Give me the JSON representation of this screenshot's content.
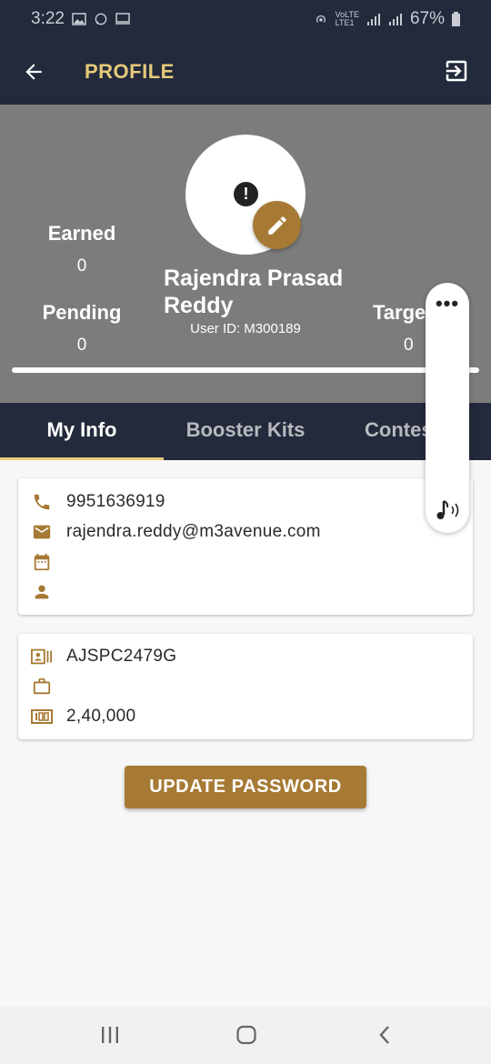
{
  "status_bar": {
    "time": "3:22",
    "network_top": "VoLTE",
    "network_bottom": "LTE1",
    "battery": "67%"
  },
  "app_bar": {
    "title": "PROFILE",
    "back_icon": "arrow-left-icon",
    "logout_icon": "logout-icon"
  },
  "profile": {
    "earned_label": "Earned",
    "earned_value": "0",
    "pending_label": "Pending",
    "pending_value": "0",
    "target_label": "Target",
    "target_value": "0",
    "name": "Rajendra Prasad Reddy",
    "user_id": "User ID: M300189",
    "alert_mark": "!"
  },
  "tabs": [
    {
      "label": "My Info",
      "active": true
    },
    {
      "label": "Booster Kits",
      "active": false
    },
    {
      "label": "Contests",
      "active": false
    }
  ],
  "info_card": {
    "phone": "9951636919",
    "email": "rajendra.reddy@m3avenue.com",
    "date": "",
    "person": ""
  },
  "id_card": {
    "pan": "AJSPC2479G",
    "job": "",
    "amount": "2,40,000"
  },
  "update_button": "UPDATE PASSWORD",
  "float_panel": {
    "dots": "•••"
  },
  "colors": {
    "dark_navy": "#232a3b",
    "gold": "#e6c97a",
    "brown_accent": "#a67a34",
    "header_gray": "#7c7c7c"
  }
}
